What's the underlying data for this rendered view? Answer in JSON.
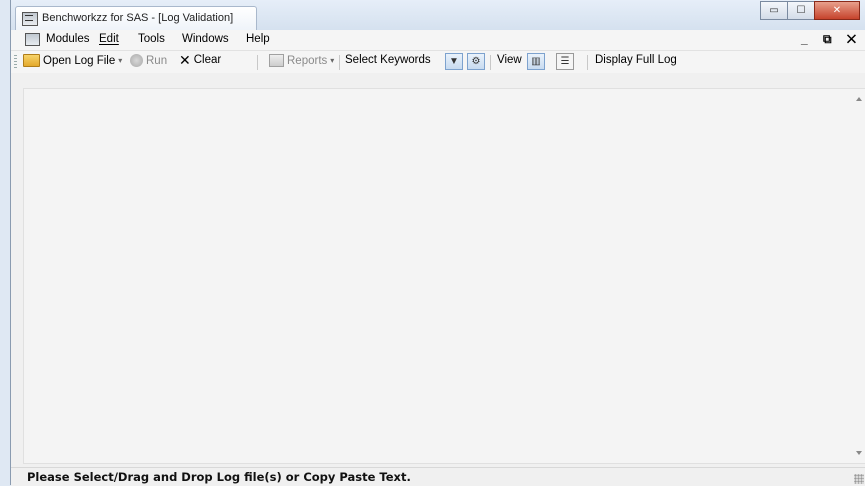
{
  "window": {
    "title": "Benchworkzz for SAS - [Log Validation]",
    "controls": {
      "minimize": "▭",
      "maximize": "☐",
      "close": "✕"
    }
  },
  "menubar": {
    "items": [
      "Modules",
      "Edit",
      "Tools",
      "Windows",
      "Help"
    ],
    "mdi_controls": "_ ⧉ ✕"
  },
  "toolbar": {
    "open_log_file": "Open Log File",
    "run": "Run",
    "clear": "Clear",
    "reports": "Reports",
    "select_keywords": "Select Keywords",
    "view": "View",
    "display_full_log": "Display Full Log",
    "dropdown_caret": "▾",
    "funnel_glyph": "▼",
    "settings_glyph": "⚙",
    "view_columns_glyph": "▥",
    "view_rows_glyph": "☰",
    "clear_glyph": "✕"
  },
  "status": {
    "text": "Please Select/Drag and Drop Log file(s) or Copy Paste Text."
  },
  "colors": {
    "accent": "#7da2ce",
    "close_button": "#c6432c"
  }
}
